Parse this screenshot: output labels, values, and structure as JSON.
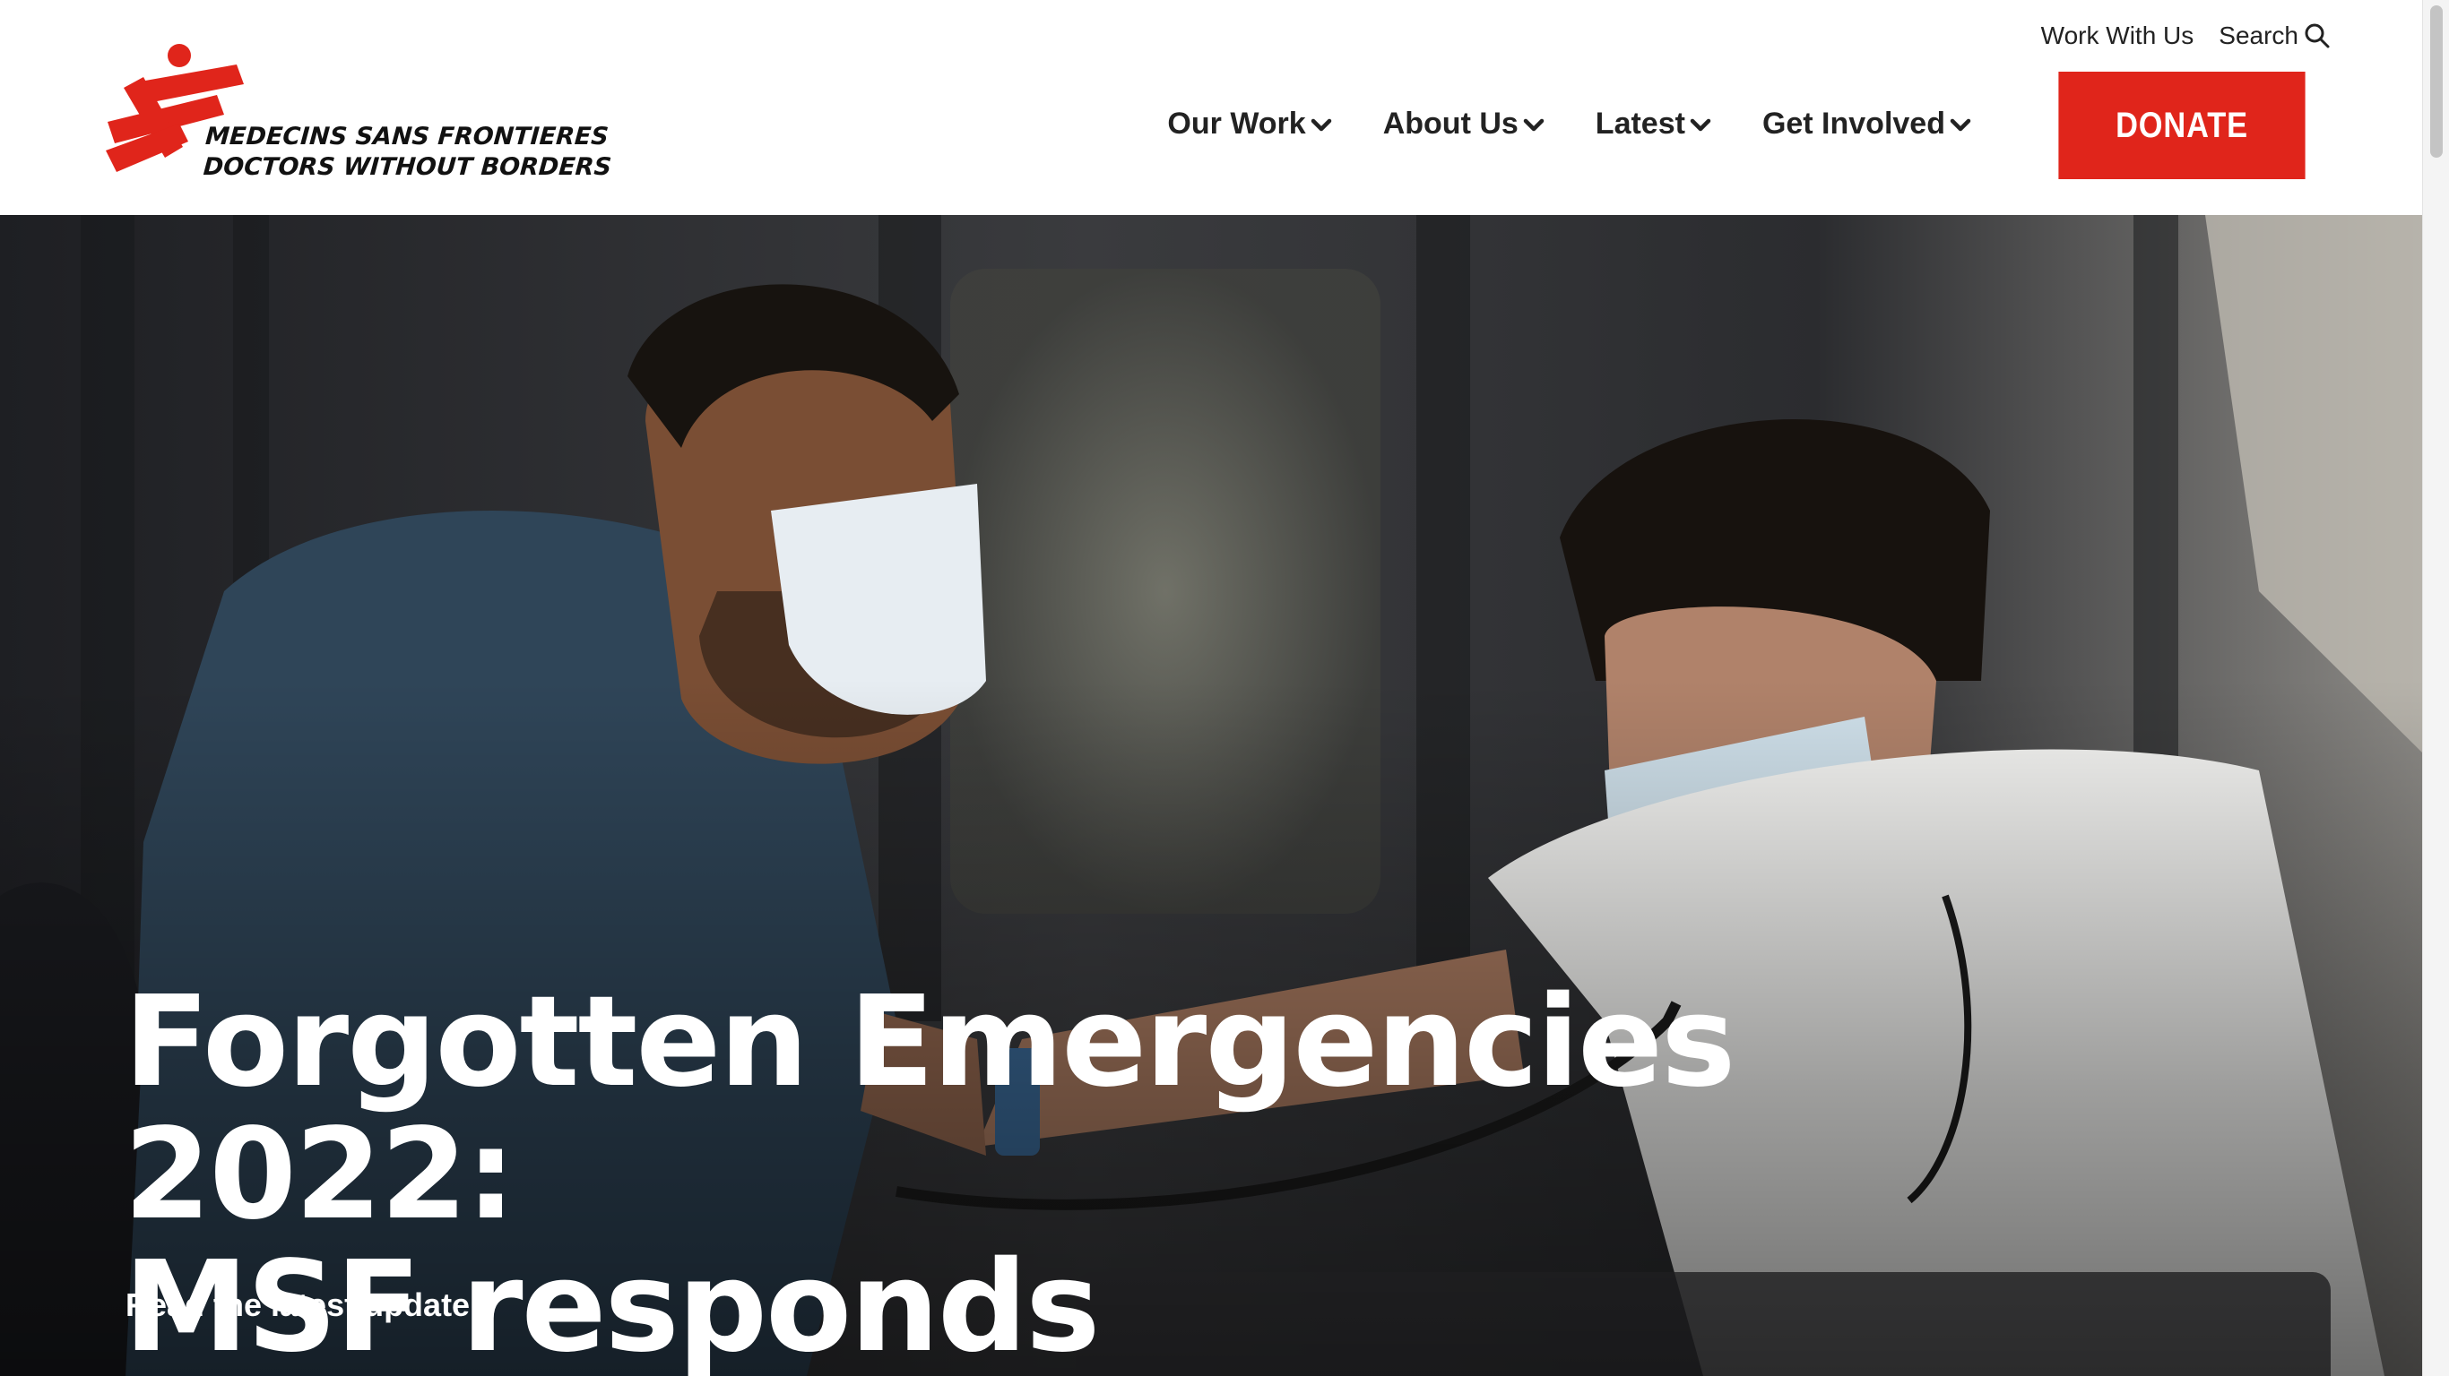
{
  "brand": {
    "name_line1": "MEDECINS SANS FRONTIERES",
    "name_line2": "DOCTORS WITHOUT BORDERS",
    "icon": "msf-running-man-logo",
    "color": "#e0251b"
  },
  "utility_nav": {
    "work_with_us": "Work With Us",
    "search": "Search",
    "search_icon": "search-icon"
  },
  "main_nav": {
    "items": [
      {
        "label": "Our Work",
        "icon": "chevron-down-icon"
      },
      {
        "label": "About Us",
        "icon": "chevron-down-icon"
      },
      {
        "label": "Latest",
        "icon": "chevron-down-icon"
      },
      {
        "label": "Get Involved",
        "icon": "chevron-down-icon"
      }
    ],
    "donate_label": "DONATE",
    "donate_color": "#e0251b"
  },
  "hero": {
    "title_line1": "Forgotten Emergencies 2022:",
    "title_line2": "MSF responds",
    "cta_label": "Read the latest update",
    "cta_icon": "chevron-right-icon"
  }
}
